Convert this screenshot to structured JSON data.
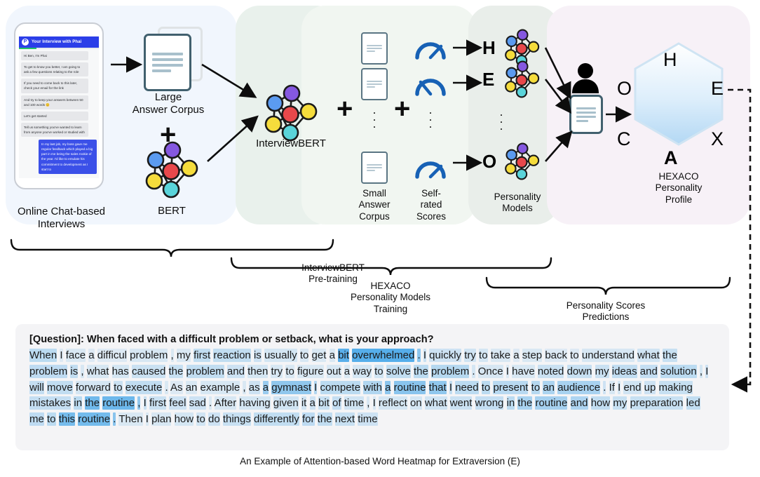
{
  "panels": {
    "stage1_color": "#f1f6fd",
    "stage2_color": "#e9f1ec",
    "stage3_color": "#f1f6f1",
    "stage4_color": "#e9eeea",
    "stage5_color": "#f7f1f7"
  },
  "phone": {
    "app_badge": "P",
    "header_title": "Your Interview with Phai",
    "messages": [
      {
        "from": "bot",
        "text": "Hi Ben, I'm Phai"
      },
      {
        "from": "bot",
        "text": "To get to know you better, I am going to ask a few questions relating to the role"
      },
      {
        "from": "bot",
        "text": "If you need to come back to this later, check your email for the link"
      },
      {
        "from": "bot",
        "text": "And try to keep your answers between 50 and 100 words 😊"
      },
      {
        "from": "bot",
        "text": "Let's get started"
      },
      {
        "from": "bot",
        "text": "Tell us something you've wanted to learn from anyone you've worked or studied with"
      },
      {
        "from": "user",
        "text": "In my last job, my boss gave me regular feedback which played a big part in me being the sales rookie of the year. I'd like to emulate his commitment to development as I start to"
      }
    ]
  },
  "labels": {
    "online_chat": "Online Chat-based\nInterviews",
    "large_corpus": "Large\nAnswer Corpus",
    "plus_1": "+",
    "bert": "BERT",
    "interviewbert": "InterviewBERT",
    "plus_2": "+",
    "plus_3": "+",
    "small_corpus": "Small\nAnswer\nCorpus",
    "self_rated": "Self-\nrated\nScores",
    "personality_models": "Personality\nModels",
    "hexaco_profile": "HEXACO\nPersonality\nProfile",
    "vertical_dots": "."
  },
  "personality_letters": [
    "H",
    "E",
    "O"
  ],
  "hexagon_vertices": {
    "top": "H",
    "top_right": "E",
    "bottom_right": "X",
    "bottom": "A",
    "bottom_left": "C",
    "top_left": "O"
  },
  "brackets": [
    {
      "id": "bracket-pretraining",
      "label": "InterviewBERT\nPre-training"
    },
    {
      "id": "bracket-training",
      "label": "HEXACO\nPersonality Models\nTraining"
    },
    {
      "id": "bracket-prediction",
      "label": "Personality Scores\nPredictions"
    }
  ],
  "heatmap": {
    "question_prefix": "[Question]:",
    "question": "When faced with a difficult problem or setback, what is your approach?",
    "caption": "An Example of Attention-based Word Heatmap for Extraversion (E)",
    "tokens": [
      {
        "t": "When",
        "w": 0.3
      },
      {
        "t": "I",
        "w": 0.08
      },
      {
        "t": "face",
        "w": 0.1
      },
      {
        "t": "a",
        "w": 0.08
      },
      {
        "t": "difficul",
        "w": 0.08
      },
      {
        "t": "problem",
        "w": 0.12
      },
      {
        "t": ",",
        "w": 0.1
      },
      {
        "t": "my",
        "w": 0.1
      },
      {
        "t": "first",
        "w": 0.26
      },
      {
        "t": "reaction",
        "w": 0.26
      },
      {
        "t": "is",
        "w": 0.18
      },
      {
        "t": "usually",
        "w": 0.14
      },
      {
        "t": "to",
        "w": 0.12
      },
      {
        "t": "get",
        "w": 0.1
      },
      {
        "t": "a",
        "w": 0.1
      },
      {
        "t": "bit",
        "w": 0.92
      },
      {
        "t": "overwhelmed",
        "w": 0.95
      },
      {
        "t": ".",
        "w": 0.6
      },
      {
        "t": "I",
        "w": 0.22
      },
      {
        "t": "quickly",
        "w": 0.18
      },
      {
        "t": "try",
        "w": 0.16
      },
      {
        "t": "to",
        "w": 0.14
      },
      {
        "t": "take",
        "w": 0.1
      },
      {
        "t": "a",
        "w": 0.08
      },
      {
        "t": "step",
        "w": 0.1
      },
      {
        "t": "back",
        "w": 0.08
      },
      {
        "t": "to",
        "w": 0.08
      },
      {
        "t": "understand",
        "w": 0.12
      },
      {
        "t": "what",
        "w": 0.16
      },
      {
        "t": "the",
        "w": 0.22
      },
      {
        "t": "problem",
        "w": 0.28
      },
      {
        "t": "is",
        "w": 0.26
      },
      {
        "t": ",",
        "w": 0.12
      },
      {
        "t": "what",
        "w": 0.12
      },
      {
        "t": "has",
        "w": 0.14
      },
      {
        "t": "caused",
        "w": 0.2
      },
      {
        "t": "the",
        "w": 0.22
      },
      {
        "t": "problem",
        "w": 0.26
      },
      {
        "t": "and",
        "w": 0.18
      },
      {
        "t": "then",
        "w": 0.14
      },
      {
        "t": "try",
        "w": 0.12
      },
      {
        "t": "to",
        "w": 0.1
      },
      {
        "t": "figure",
        "w": 0.1
      },
      {
        "t": "out",
        "w": 0.12
      },
      {
        "t": "a",
        "w": 0.1
      },
      {
        "t": "way",
        "w": 0.14
      },
      {
        "t": "to",
        "w": 0.16
      },
      {
        "t": "solve",
        "w": 0.26
      },
      {
        "t": "the",
        "w": 0.3
      },
      {
        "t": "problem",
        "w": 0.34
      },
      {
        "t": ".",
        "w": 0.14
      },
      {
        "t": "Once",
        "w": 0.12
      },
      {
        "t": "I",
        "w": 0.1
      },
      {
        "t": "have",
        "w": 0.12
      },
      {
        "t": "noted",
        "w": 0.2
      },
      {
        "t": "down",
        "w": 0.22
      },
      {
        "t": "my",
        "w": 0.2
      },
      {
        "t": "ideas",
        "w": 0.26
      },
      {
        "t": "and",
        "w": 0.24
      },
      {
        "t": "solution",
        "w": 0.3
      },
      {
        "t": ",",
        "w": 0.14
      },
      {
        "t": "I",
        "w": 0.18
      },
      {
        "t": "will",
        "w": 0.24
      },
      {
        "t": "move",
        "w": 0.26
      },
      {
        "t": "forward",
        "w": 0.14
      },
      {
        "t": "to",
        "w": 0.2
      },
      {
        "t": "execute",
        "w": 0.26
      },
      {
        "t": ".",
        "w": 0.1
      },
      {
        "t": "As",
        "w": 0.08
      },
      {
        "t": "an",
        "w": 0.1
      },
      {
        "t": "example",
        "w": 0.12
      },
      {
        "t": ",",
        "w": 0.1
      },
      {
        "t": "as",
        "w": 0.18
      },
      {
        "t": "a",
        "w": 0.52
      },
      {
        "t": "gymnast",
        "w": 0.58
      },
      {
        "t": "I",
        "w": 0.36
      },
      {
        "t": "compete",
        "w": 0.3
      },
      {
        "t": "with",
        "w": 0.36
      },
      {
        "t": "a",
        "w": 0.6
      },
      {
        "t": "routine",
        "w": 0.62
      },
      {
        "t": "that",
        "w": 0.58
      },
      {
        "t": "I",
        "w": 0.26
      },
      {
        "t": "need",
        "w": 0.3
      },
      {
        "t": "to",
        "w": 0.3
      },
      {
        "t": "present",
        "w": 0.32
      },
      {
        "t": "to",
        "w": 0.34
      },
      {
        "t": "an",
        "w": 0.4
      },
      {
        "t": "audience",
        "w": 0.42
      },
      {
        "t": ".",
        "w": 0.18
      },
      {
        "t": "If",
        "w": 0.12
      },
      {
        "t": "I",
        "w": 0.14
      },
      {
        "t": "end",
        "w": 0.16
      },
      {
        "t": "up",
        "w": 0.18
      },
      {
        "t": "making",
        "w": 0.22
      },
      {
        "t": "mistakes",
        "w": 0.24
      },
      {
        "t": "in",
        "w": 0.3
      },
      {
        "t": "the",
        "w": 0.78
      },
      {
        "t": "routine",
        "w": 0.8
      },
      {
        "t": ",",
        "w": 0.56
      },
      {
        "t": "I",
        "w": 0.22
      },
      {
        "t": "first",
        "w": 0.2
      },
      {
        "t": "feel",
        "w": 0.18
      },
      {
        "t": "sad",
        "w": 0.18
      },
      {
        "t": ".",
        "w": 0.1
      },
      {
        "t": "After",
        "w": 0.12
      },
      {
        "t": "having",
        "w": 0.14
      },
      {
        "t": "given",
        "w": 0.16
      },
      {
        "t": "it",
        "w": 0.16
      },
      {
        "t": "a",
        "w": 0.18
      },
      {
        "t": "bit",
        "w": 0.22
      },
      {
        "t": "of",
        "w": 0.24
      },
      {
        "t": "time",
        "w": 0.16
      },
      {
        "t": ",",
        "w": 0.1
      },
      {
        "t": "I",
        "w": 0.12
      },
      {
        "t": "reflect",
        "w": 0.14
      },
      {
        "t": "on",
        "w": 0.14
      },
      {
        "t": "what",
        "w": 0.16
      },
      {
        "t": "went",
        "w": 0.2
      },
      {
        "t": "wrong",
        "w": 0.24
      },
      {
        "t": "in",
        "w": 0.3
      },
      {
        "t": "the",
        "w": 0.42
      },
      {
        "t": "routine",
        "w": 0.44
      },
      {
        "t": "and",
        "w": 0.38
      },
      {
        "t": "how",
        "w": 0.26
      },
      {
        "t": "my",
        "w": 0.22
      },
      {
        "t": "preparation",
        "w": 0.22
      },
      {
        "t": "led",
        "w": 0.26
      },
      {
        "t": "me",
        "w": 0.28
      },
      {
        "t": "to",
        "w": 0.3
      },
      {
        "t": "this",
        "w": 0.74
      },
      {
        "t": "routine",
        "w": 0.76
      },
      {
        "t": ".",
        "w": 0.62
      },
      {
        "t": "Then",
        "w": 0.1
      },
      {
        "t": "I",
        "w": 0.1
      },
      {
        "t": "plan",
        "w": 0.12
      },
      {
        "t": "how",
        "w": 0.14
      },
      {
        "t": "to",
        "w": 0.16
      },
      {
        "t": "do",
        "w": 0.18
      },
      {
        "t": "things",
        "w": 0.22
      },
      {
        "t": "differently",
        "w": 0.26
      },
      {
        "t": "for",
        "w": 0.28
      },
      {
        "t": "the",
        "w": 0.26
      },
      {
        "t": "next",
        "w": 0.22
      },
      {
        "t": "time",
        "w": 0.18
      }
    ]
  },
  "colors": {
    "node_blue": "#5b9bf0",
    "node_purple": "#8558e0",
    "node_red": "#e8484b",
    "node_yellow": "#f5dc3c",
    "node_cyan": "#5ad4da",
    "gauge_blue": "#1761b5",
    "doc_outline": "#41606e",
    "hex_fill_top": "#ffffff",
    "hex_fill_bottom": "#b5d9f5",
    "highlight": "#4aa8e8"
  }
}
